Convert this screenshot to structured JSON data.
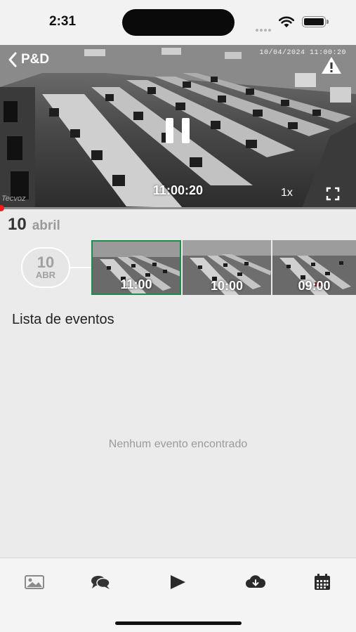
{
  "status_bar": {
    "time": "2:31"
  },
  "header": {
    "back_label": "P&D"
  },
  "video": {
    "overlay_timestamp": "10/04/2024 11:00:20",
    "playback_time": "11:00:20",
    "speed": "1x",
    "watermark": "Tecvoz",
    "progress": 0.0
  },
  "date_header": {
    "day": "10",
    "month": "abril"
  },
  "timeline": {
    "day_badge": {
      "day": "10",
      "month": "ABR"
    },
    "thumbnails": [
      {
        "label": "11:00",
        "selected": true
      },
      {
        "label": "10:00",
        "selected": false
      },
      {
        "label": "09:00",
        "selected": false
      }
    ]
  },
  "events": {
    "title": "Lista de eventos",
    "empty_message": "Nenhum evento encontrado"
  },
  "tab_bar": {
    "items": [
      {
        "icon": "image-icon"
      },
      {
        "icon": "comments-icon"
      },
      {
        "icon": "play-icon"
      },
      {
        "icon": "cloud-download-icon"
      },
      {
        "icon": "calendar-icon"
      }
    ]
  },
  "colors": {
    "accent_green": "#1e8c4a",
    "progress_red": "#ff1a1a"
  }
}
